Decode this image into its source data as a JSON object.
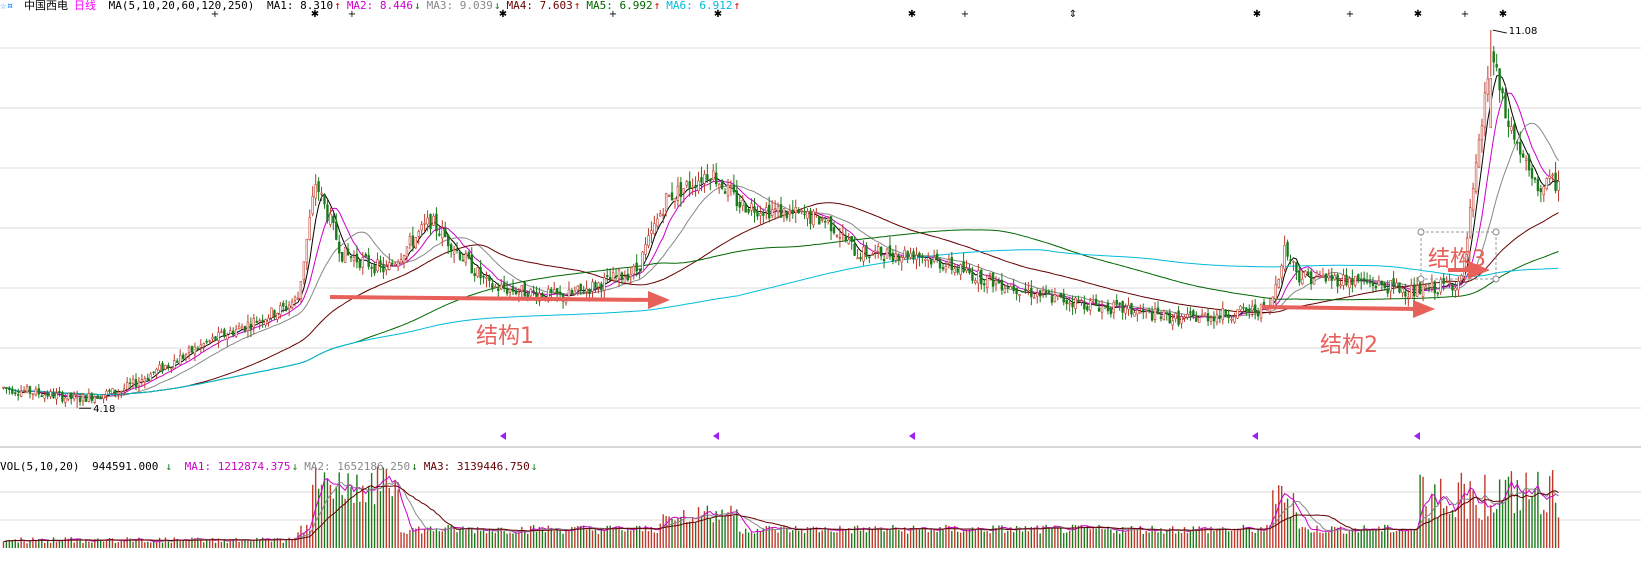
{
  "header": {
    "logo": "☆¤",
    "stock_name": "中国西电",
    "period": "日线",
    "ma_spec": "MA(5,10,20,60,120,250)",
    "ma_items": [
      {
        "label": "MA1:",
        "value": "8.310",
        "dir": "↑",
        "color": "#000000"
      },
      {
        "label": "MA2:",
        "value": "8.446",
        "dir": "↓",
        "color": "#cc00cc"
      },
      {
        "label": "MA3:",
        "value": "9.039",
        "dir": "↓",
        "color": "#888888"
      },
      {
        "label": "MA4:",
        "value": "7.603",
        "dir": "↑",
        "color": "#660000"
      },
      {
        "label": "MA5:",
        "value": "6.992",
        "dir": "↑",
        "color": "#006600"
      },
      {
        "label": "MA6:",
        "value": "6.912",
        "dir": "↑",
        "color": "#00bbdd"
      }
    ]
  },
  "volume_header": {
    "spec": "VOL(5,10,20)",
    "value": "944591.000",
    "value_dir": "↓",
    "ma_items": [
      {
        "label": "MA1:",
        "value": "1212874.375",
        "dir": "↓",
        "color": "#cc00cc"
      },
      {
        "label": "MA2:",
        "value": "1652186.250",
        "dir": "↓",
        "color": "#888888"
      },
      {
        "label": "MA3:",
        "value": "3139446.750",
        "dir": "↓",
        "color": "#660000"
      }
    ]
  },
  "colors": {
    "up": "#c0392b",
    "down": "#1a7a1a",
    "arrow": "#e8605a",
    "ma1": "#000000",
    "ma2": "#cc00cc",
    "ma3": "#888888",
    "ma4": "#660000",
    "ma5": "#006600",
    "ma6": "#00bbdd",
    "grid": "#d8d8d8"
  },
  "annotations": {
    "low_label": "4.18",
    "high_label": "11.08",
    "structure_labels": [
      "结构1",
      "结构2",
      "结构3"
    ]
  },
  "chart_data": {
    "type": "candlestick",
    "title": "中国西电 日线",
    "y_range": [
      3.6,
      11.3
    ],
    "low_price": 4.18,
    "high_price": 11.08,
    "price_trend_anchors": [
      [
        0,
        4.55
      ],
      [
        25,
        4.35
      ],
      [
        40,
        4.5
      ],
      [
        70,
        5.4
      ],
      [
        95,
        6.0
      ],
      [
        100,
        6.2
      ],
      [
        106,
        8.3
      ],
      [
        115,
        7.0
      ],
      [
        130,
        6.7
      ],
      [
        145,
        7.6
      ],
      [
        165,
        6.4
      ],
      [
        190,
        6.2
      ],
      [
        215,
        6.7
      ],
      [
        225,
        8.0
      ],
      [
        240,
        8.5
      ],
      [
        250,
        7.9
      ],
      [
        280,
        7.6
      ],
      [
        290,
        7.0
      ],
      [
        310,
        7.0
      ],
      [
        330,
        6.6
      ],
      [
        355,
        6.2
      ],
      [
        400,
        5.8
      ],
      [
        430,
        6.0
      ],
      [
        435,
        7.1
      ],
      [
        440,
        6.6
      ],
      [
        460,
        6.5
      ],
      [
        480,
        6.3
      ],
      [
        495,
        6.5
      ],
      [
        500,
        8.5
      ],
      [
        505,
        10.7
      ],
      [
        510,
        9.5
      ],
      [
        520,
        8.2
      ],
      [
        528,
        8.31
      ]
    ],
    "moving_averages": [
      "MA(5)",
      "MA(10)",
      "MA(20)",
      "MA(60)",
      "MA(120)",
      "MA(250)"
    ]
  }
}
